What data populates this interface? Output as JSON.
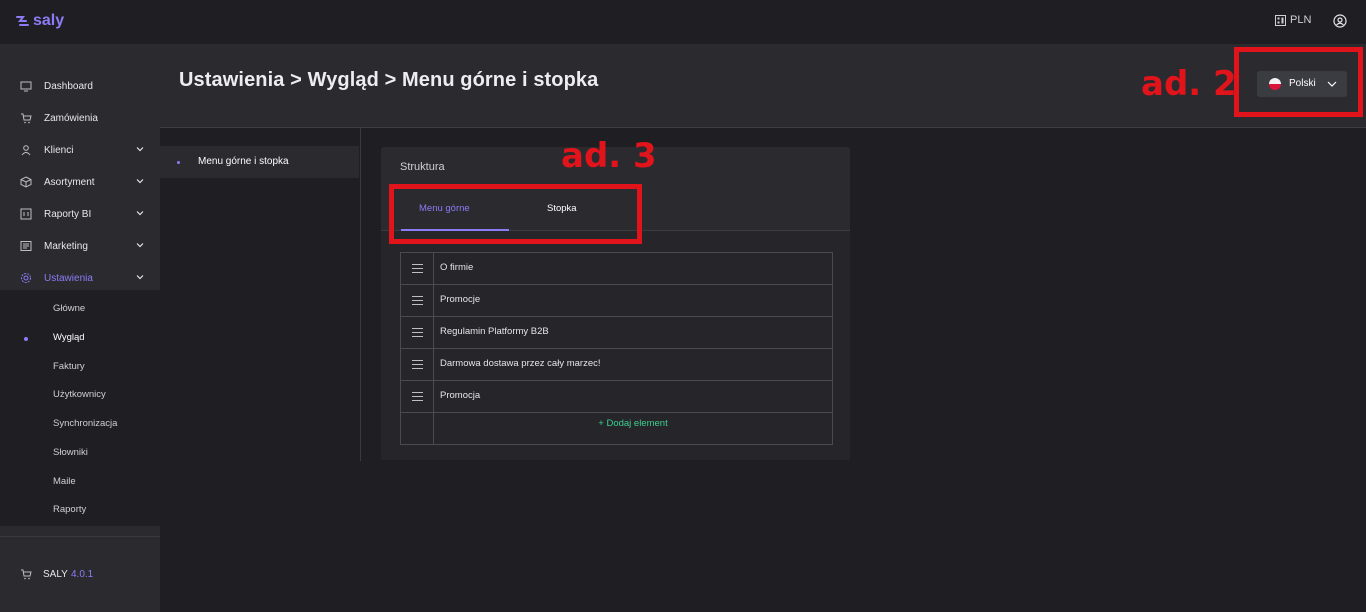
{
  "app": {
    "logo_text": "saly",
    "brand_color": "#8b7cf6"
  },
  "topbar": {
    "currency_label": "PLN",
    "currency_icon": "currency-icon",
    "user_icon": "user-icon"
  },
  "sidebar": {
    "items": [
      {
        "label": "Dashboard",
        "icon": "monitor-icon",
        "expandable": false
      },
      {
        "label": "Zamówienia",
        "icon": "cart-icon",
        "expandable": false
      },
      {
        "label": "Klienci",
        "icon": "user-icon",
        "expandable": true
      },
      {
        "label": "Asortyment",
        "icon": "box-icon",
        "expandable": true
      },
      {
        "label": "Raporty BI",
        "icon": "report-icon",
        "expandable": true
      },
      {
        "label": "Marketing",
        "icon": "newspaper-icon",
        "expandable": true
      },
      {
        "label": "Ustawienia",
        "icon": "gear-icon",
        "expandable": true,
        "active": true
      }
    ],
    "sub_items": [
      {
        "label": "Główne"
      },
      {
        "label": "Wygląd",
        "active": true
      },
      {
        "label": "Faktury"
      },
      {
        "label": "Użytkownicy"
      },
      {
        "label": "Synchronizacja"
      },
      {
        "label": "Słowniki"
      },
      {
        "label": "Maile"
      },
      {
        "label": "Raporty"
      }
    ],
    "footer": {
      "label": "SALY",
      "version": "4.0.1"
    }
  },
  "header": {
    "title": "Ustawienia > Wygląd > Menu górne i stopka",
    "language": {
      "label": "Polski",
      "flag": "poland-flag-icon"
    }
  },
  "annotations": {
    "ad2": "ad. 2",
    "ad3": "ad. 3",
    "color": "#e1141c"
  },
  "subsidebar": {
    "item": "Menu górne i stopka"
  },
  "card": {
    "title": "Struktura",
    "tabs": [
      {
        "label": "Menu górne",
        "active": true
      },
      {
        "label": "Stopka",
        "active": false
      }
    ],
    "rows": [
      "O firmie",
      "Promocje",
      "Regulamin Platformy B2B",
      "Darmowa dostawa przez cały marzec!",
      "Promocja"
    ],
    "add_label": "+ Dodaj element"
  }
}
